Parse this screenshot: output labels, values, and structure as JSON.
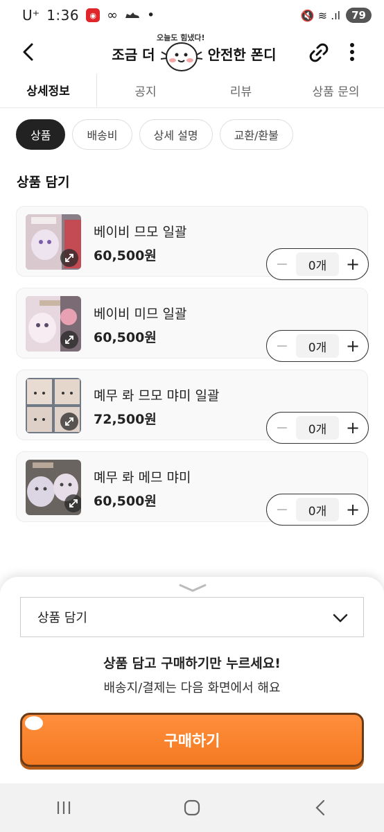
{
  "status_bar": {
    "carrier": "U⁺",
    "time": "1:36",
    "app_badge": "◉",
    "icon_glyph": "∞",
    "dot": "•",
    "right_icons": "🔇 ≋ .ıl",
    "battery": "79"
  },
  "header": {
    "title_left": "조금 더",
    "title_right": "안전한 폰디",
    "mascot_caption": "오늘도 힘냈다!"
  },
  "tabs": [
    {
      "label": "상세정보",
      "active": true
    },
    {
      "label": "공지",
      "active": false
    },
    {
      "label": "리뷰",
      "active": false
    },
    {
      "label": "상품 문의",
      "active": false
    }
  ],
  "chips": [
    {
      "label": "상품",
      "active": true
    },
    {
      "label": "배송비",
      "active": false
    },
    {
      "label": "상세 설명",
      "active": false
    },
    {
      "label": "교환/환불",
      "active": false
    }
  ],
  "section_title": "상품 담기",
  "products": [
    {
      "name": "베이비 므모 일괄",
      "price": "60,500원",
      "qty": "0개",
      "minus": "−",
      "plus": "+"
    },
    {
      "name": "베이비 미므 일괄",
      "price": "60,500원",
      "qty": "0개",
      "minus": "−",
      "plus": "+"
    },
    {
      "name": "몌무 롸 므모 먀미 일괄",
      "price": "72,500원",
      "qty": "0개",
      "minus": "−",
      "plus": "+"
    },
    {
      "name": "몌무 롸 메므 먀미",
      "price": "60,500원",
      "qty": "0개",
      "minus": "−",
      "plus": "+"
    }
  ],
  "sheet": {
    "select_label": "상품 담기",
    "notice_main": "상품 담고 구매하기만 누르세요!",
    "notice_sub": "배송지/결제는 다음 화면에서 해요",
    "buy_label": "구매하기"
  },
  "colors": {
    "buy_button": "#f47a22",
    "chip_active": "#222222"
  }
}
